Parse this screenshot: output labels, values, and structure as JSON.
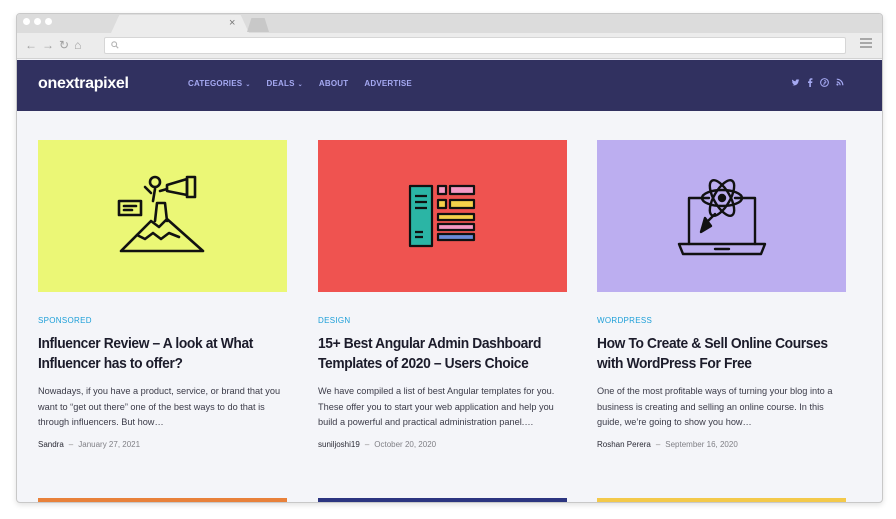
{
  "browser": {
    "tab_close": "×",
    "nav_buttons": [
      "←",
      "→",
      "↻",
      "⌂"
    ],
    "url_icon": "search-icon"
  },
  "site": {
    "logo": "onextrapixel",
    "nav": [
      {
        "label": "CATEGORIES",
        "dropdown": true
      },
      {
        "label": "DEALS",
        "dropdown": true
      },
      {
        "label": "ABOUT",
        "dropdown": false
      },
      {
        "label": "ADVERTISE",
        "dropdown": false
      }
    ],
    "social": [
      "twitter-icon",
      "facebook-icon",
      "pinterest-icon",
      "rss-icon"
    ],
    "colors": {
      "header_bg": "#313160",
      "nav_text": "#a5a9f2",
      "category": "#1d9fd8"
    }
  },
  "posts": [
    {
      "image_bg": "#ebf776",
      "icon": "influencer-megaphone-icon",
      "category": "SPONSORED",
      "title": "Influencer Review – A look at What Influencer has to offer?",
      "excerpt": "Nowadays, if you have a product, service, or brand that you want to “get out there” one of the best ways to do that is through influencers. But how…",
      "author": "Sandra",
      "separator": "–",
      "date": "January 27, 2021"
    },
    {
      "image_bg": "#ef5350",
      "icon": "admin-dashboard-icon",
      "category": "DESIGN",
      "title": "15+ Best Angular Admin Dashboard Templates of 2020 – Users Choice",
      "excerpt": "We have compiled a list of best Angular templates for you. These offer you to start your web application and help you build a powerful and practical administration panel.…",
      "author": "suniljoshi19",
      "separator": "–",
      "date": "October 20, 2020"
    },
    {
      "image_bg": "#bcaef0",
      "icon": "laptop-atom-icon",
      "category": "WORDPRESS",
      "title": "How To Create & Sell Online Courses with WordPress For Free",
      "excerpt": "One of the most profitable ways of turning your blog into a business is creating and selling an online course. In this guide, we’re going to show you how…",
      "author": "Roshan Perera",
      "separator": "–",
      "date": "September 16, 2020"
    }
  ],
  "next_row_colors": [
    "#e8813a",
    "#2c3580",
    "#f3c94a"
  ]
}
